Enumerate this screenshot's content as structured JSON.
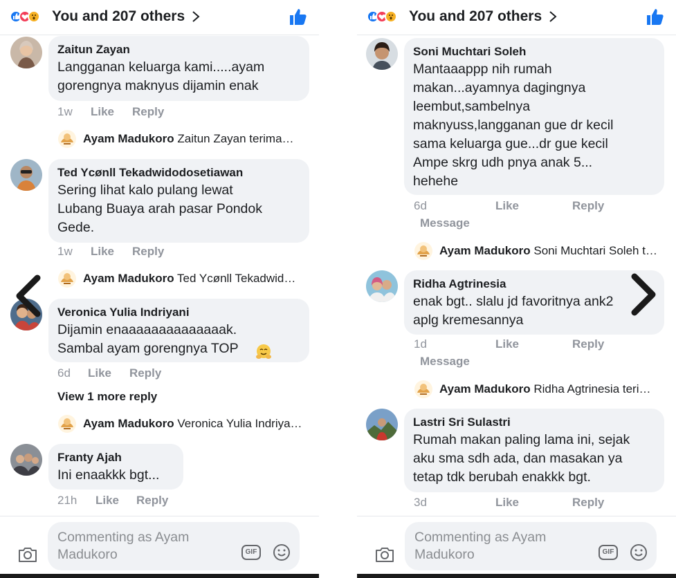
{
  "header": {
    "reactions_text": "You and 207 others"
  },
  "left": {
    "comments": [
      {
        "author": "Zaitun Zayan",
        "text": "Langganan keluarga kami.....ayam\ngorengnya maknyus dijamin enak",
        "time": "1w",
        "like": "Like",
        "reply": "Reply",
        "reply_preview": {
          "author": "Ayam Madukoro",
          "text": "Zaitun Zayan terima…"
        }
      },
      {
        "author": "Ted Ycønll Tekadwidodosetiawan",
        "text": "Sering lihat kalo pulang lewat\nLubang Buaya arah pasar Pondok\nGede.",
        "time": "1w",
        "like": "Like",
        "reply": "Reply",
        "reply_preview": {
          "author": "Ayam Madukoro",
          "text": "Ted Ycønll Tekadwid…"
        }
      },
      {
        "author": "Veronica Yulia Indriyani",
        "text": "Dijamin enaaaaaaaaaaaaaak.\nSambal ayam gorengnya TOP",
        "time": "6d",
        "like": "Like",
        "reply": "Reply",
        "view_more": "View 1 more reply",
        "reply_preview": {
          "author": "Ayam Madukoro",
          "text": "Veronica Yulia Indriya…"
        }
      },
      {
        "author": "Franty Ajah",
        "text": "Ini enaakkk bgt...",
        "time": "21h",
        "like": "Like",
        "reply": "Reply"
      }
    ],
    "composer_placeholder": "Commenting as Ayam Madukoro",
    "gif_label": "GIF"
  },
  "right": {
    "comments": [
      {
        "author": "Soni Muchtari Soleh",
        "text": "Mantaaappp nih rumah\nmakan...ayamnya dagingnya\nleembut,sambelnya\nmaknyuss,langganan gue dr kecil\nsama keluarga gue...dr gue kecil\nAmpe skrg udh pnya anak 5...\nhehehe",
        "time": "6d",
        "like": "Like",
        "reply": "Reply",
        "message": "Message",
        "reply_preview": {
          "author": "Ayam Madukoro",
          "text": "Soni Muchtari Soleh t…"
        }
      },
      {
        "author": "Ridha Agtrinesia",
        "text": "enak bgt.. slalu jd favoritnya ank2\naplg kremesannya",
        "time": "1d",
        "like": "Like",
        "reply": "Reply",
        "message": "Message",
        "reply_preview": {
          "author": "Ayam Madukoro",
          "text": "Ridha Agtrinesia teri…"
        }
      },
      {
        "author": "Lastri Sri Sulastri",
        "text": "Rumah makan paling lama ini, sejak\naku sma sdh ada, dan masakan ya\ntetap tdk berubah enakkk bgt.",
        "time": "3d",
        "like": "Like",
        "reply": "Reply"
      }
    ],
    "composer_placeholder": "Commenting as Ayam Madukoro",
    "gif_label": "GIF"
  },
  "colors": {
    "brand_blue": "#1877f2",
    "love_red": "#f33e58",
    "wow_yellow": "#f7b125",
    "bubble_bg": "#f0f2f5",
    "meta_gray": "#90949c"
  },
  "icons": [
    "like-reaction-icon",
    "love-reaction-icon",
    "wow-reaction-icon",
    "chevron-right-icon",
    "thumbs-up-icon",
    "camera-icon",
    "gif-icon",
    "emoji-icon",
    "arrow-left-icon",
    "arrow-right-icon"
  ]
}
